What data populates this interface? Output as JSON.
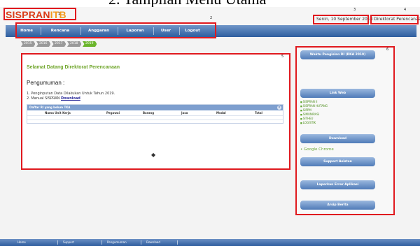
{
  "document": {
    "heading": "2. Tampilan Menu Utama"
  },
  "header": {
    "logo_part1": "SISPRAN",
    "logo_part2": "ITB",
    "date": "Senin, 10 September 2018",
    "user": "Direktorat Perencanaan"
  },
  "annotations": {
    "n1": "1",
    "n2": "2",
    "n3": "3",
    "n4": "4",
    "n5": "5",
    "n6": "6"
  },
  "nav": {
    "items": [
      {
        "label": "Home"
      },
      {
        "label": "Rencana Kerja"
      },
      {
        "label": "Anggaran"
      },
      {
        "label": "Laporan"
      },
      {
        "label": "User"
      },
      {
        "label": "Logout"
      }
    ]
  },
  "years": [
    "2015",
    "2016",
    "2017",
    "2018",
    "2019"
  ],
  "active_year": "2019",
  "main": {
    "welcome": "Selamat Datang Direktorat Perencanaan",
    "announcement_title": "Pengumuman :",
    "line1": "1. Penginputan Data Dilakukan Untuk Tahun 2019.",
    "line2_prefix": "2. Manual SISPRAN ",
    "line2_link": "Download",
    "table": {
      "title": "Daftar RI yang belum TKA",
      "columns": [
        "Nama Unit Kerja",
        "Pegawai",
        "Barang",
        "Jasa",
        "Modal",
        "Total"
      ]
    },
    "pager_icon": "◆"
  },
  "sidebar": {
    "deadline_btn": "Waktu Pengisian RI (RKA 2019)",
    "link_web_btn": "Link Web",
    "links": [
      "SISPRAN II",
      "SISPRAN HUTANG",
      "SIPPM",
      "SIMUNIRASI",
      "SITHEU",
      "LOGISTIK"
    ],
    "download_btn": "Download",
    "chrome_link": "Google Chrome",
    "support_btn": "Support Asisten",
    "error_btn": "Laporkan Error Aplikasi",
    "archive_btn": "Arsip Berita"
  },
  "footer": {
    "items": [
      "Home",
      "Support",
      "Pengumuman",
      "Download"
    ]
  },
  "colors": {
    "accent_red": "#e0191e",
    "nav_blue": "#2e5e9f",
    "welcome_green": "#6fa52a",
    "active_year": "#6bb52c"
  }
}
